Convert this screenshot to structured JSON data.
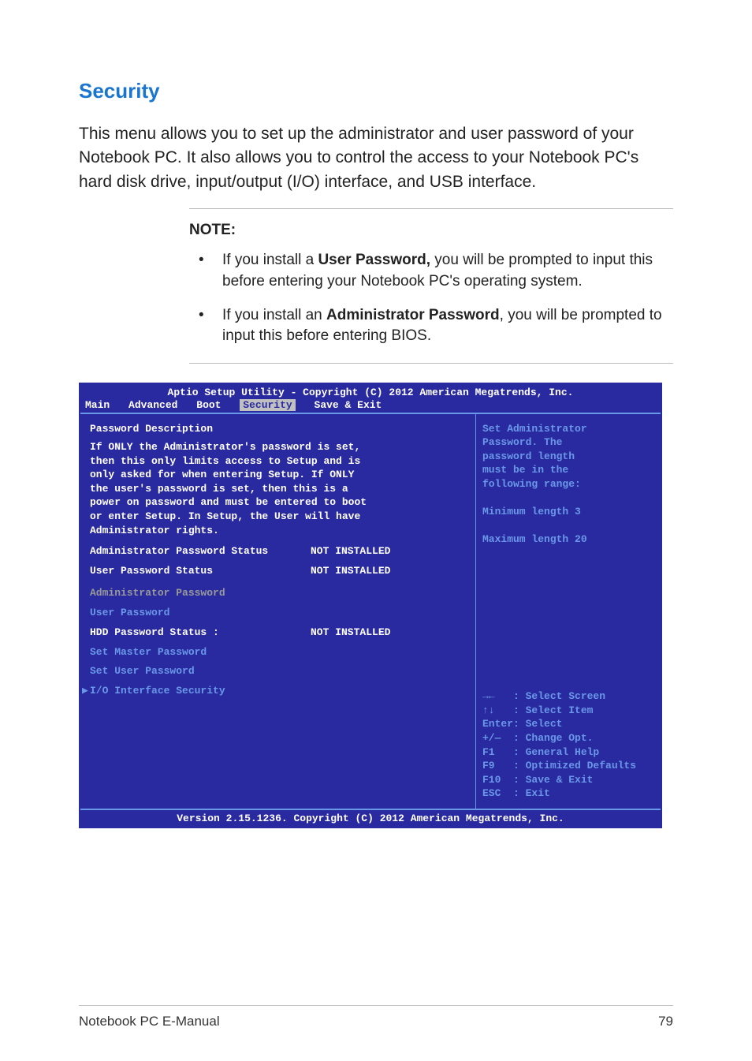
{
  "section_title": "Security",
  "intro": "This menu allows you to set up the administrator and user password of your Notebook PC. It also allows you to control the access to your Notebook PC's hard disk drive, input/output (I/O) interface, and USB interface.",
  "note": {
    "label": "NOTE:",
    "items": [
      {
        "pre": "If you install a ",
        "bold": "User Password,",
        "post": " you will be prompted to input this before entering your Notebook PC's operating system."
      },
      {
        "pre": "If you install an ",
        "bold": "Administrator Password",
        "post": ", you will be prompted to input this before entering BIOS."
      }
    ]
  },
  "bios": {
    "header": "Aptio Setup Utility - Copyright (C) 2012 American Megatrends, Inc.",
    "tabs": [
      "Main",
      "Advanced",
      "Boot",
      "Security",
      "Save & Exit"
    ],
    "active_tab": "Security",
    "left": {
      "title": "Password Description",
      "desc": [
        "If ONLY the Administrator's password is set,",
        "then this only limits access to Setup and is",
        "only asked for when entering Setup. If ONLY",
        "the user's password is set, then this is a",
        "power on password and must be entered to boot",
        "or enter Setup. In Setup, the User will have",
        "Administrator rights."
      ],
      "rows": [
        {
          "label": "Administrator Password Status",
          "value": "NOT INSTALLED",
          "cls": "white"
        },
        {
          "label": "User Password Status",
          "value": "NOT INSTALLED",
          "cls": "white"
        }
      ],
      "links": [
        {
          "label": "Administrator Password",
          "cls": "gray"
        },
        {
          "label": "User Password",
          "cls": "blue"
        }
      ],
      "hdd_row": {
        "label": "HDD Password Status :",
        "value": "NOT INSTALLED"
      },
      "master": "Set Master Password",
      "user": "Set User Password",
      "io": "I/O Interface Security"
    },
    "right_help": [
      "Set Administrator",
      "Password. The",
      "password length",
      "must be in the",
      "following range:",
      "",
      "Minimum length 3",
      "",
      "Maximum length 20"
    ],
    "key_help": [
      "→←   : Select Screen",
      "↑↓   : Select Item",
      "Enter: Select",
      "+/—  : Change Opt.",
      "F1   : General Help",
      "F9   : Optimized Defaults",
      "F10  : Save & Exit",
      "ESC  : Exit"
    ],
    "footer": "Version 2.15.1236. Copyright (C) 2012 American Megatrends, Inc."
  },
  "page_footer": {
    "left": "Notebook PC E-Manual",
    "right": "79"
  }
}
